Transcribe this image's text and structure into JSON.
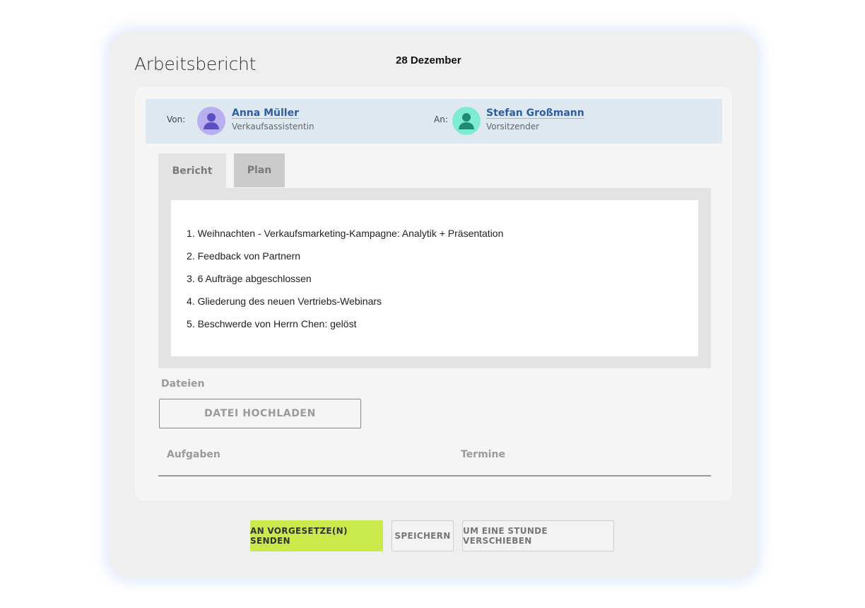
{
  "header": {
    "title": "Arbeitsbericht",
    "date": "28 Dezember"
  },
  "people": {
    "from_label": "Von:",
    "from_name": "Anna Müller",
    "from_role": "Verkaufsassistentin",
    "to_label": "An:",
    "to_name": "Stefan Großmann",
    "to_role": "Vorsitzender"
  },
  "tabs": [
    {
      "label": "Bericht",
      "active": true
    },
    {
      "label": "Plan",
      "active": false
    }
  ],
  "report": {
    "items": [
      "1. Weihnachten - Verkaufsmarketing-Kampagne: Analytik + Präsentation",
      "2.  Feedback von Partnern",
      "3. 6 Aufträge abgeschlossen",
      "4.  Gliederung des neuen Vertriebs-Webinars",
      "5. Beschwerde von Herrn Chen: gelöst"
    ]
  },
  "files": {
    "label": "Dateien",
    "upload_label": "DATEI HOCHLADEN"
  },
  "table": {
    "col_tasks": "Aufgaben",
    "col_dates": "Termine"
  },
  "actions": {
    "send_label": "AN VORGESETZE(N) SENDEN",
    "save_label": "SPEICHERN",
    "shift_label": "UM EINE STUNDE VERSCHIEBEN"
  },
  "colors": {
    "accent_send": "#c9ea4a",
    "avatar_from": "#b9aef0",
    "avatar_to": "#7eecd0",
    "link": "#2b5ea7",
    "people_bar": "#dde8f1"
  }
}
